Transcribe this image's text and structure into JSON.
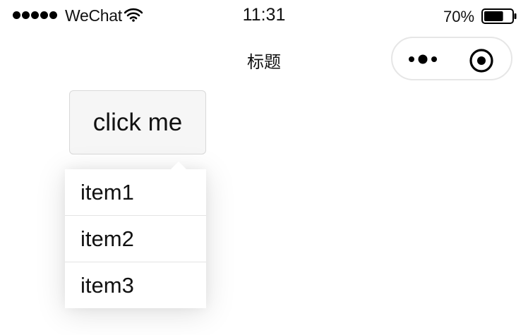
{
  "status_bar": {
    "carrier": "WeChat",
    "time": "11:31",
    "battery_percent": "70%",
    "battery_level": 0.7,
    "icons": [
      "signal-dots-icon",
      "wifi-icon",
      "battery-icon"
    ]
  },
  "nav": {
    "title": "标题",
    "capsule": {
      "icons": [
        "more-dots-icon",
        "close-target-icon"
      ]
    }
  },
  "main": {
    "button_label": "click me",
    "menu": {
      "items": [
        {
          "label": "item1"
        },
        {
          "label": "item2"
        },
        {
          "label": "item3"
        }
      ]
    }
  },
  "colors": {
    "button_bg": "#f6f6f6",
    "button_border": "#d9d9d9",
    "capsule_border": "#e6e6e6",
    "divider": "#e4e4e4"
  }
}
